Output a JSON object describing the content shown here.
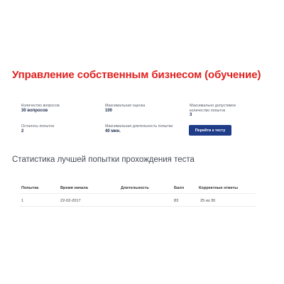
{
  "page": {
    "title": "Управление собственным бизнесом (обучение)"
  },
  "info": {
    "questions_label": "Количество вопросов",
    "questions_value": "30 вопросов",
    "max_score_label": "Максимальная оценка",
    "max_score_value": "100",
    "max_attempts_label": "Максимально допустимое количество попыток",
    "max_attempts_value": "3",
    "remaining_label": "Осталось попыток",
    "remaining_value": "2",
    "max_duration_label": "Максимальная длительность попытки",
    "max_duration_value": "40 мин."
  },
  "actions": {
    "goto_test_label": "Перейти к тесту"
  },
  "stats": {
    "title": "Статистика лучшей попытки прохождения теста",
    "headers": [
      "Попытка",
      "Время начала",
      "Длительность",
      "Балл",
      "Корректные ответы"
    ],
    "rows": [
      [
        "1",
        "22-02-2017",
        "",
        "83",
        "25 из 30"
      ]
    ]
  }
}
